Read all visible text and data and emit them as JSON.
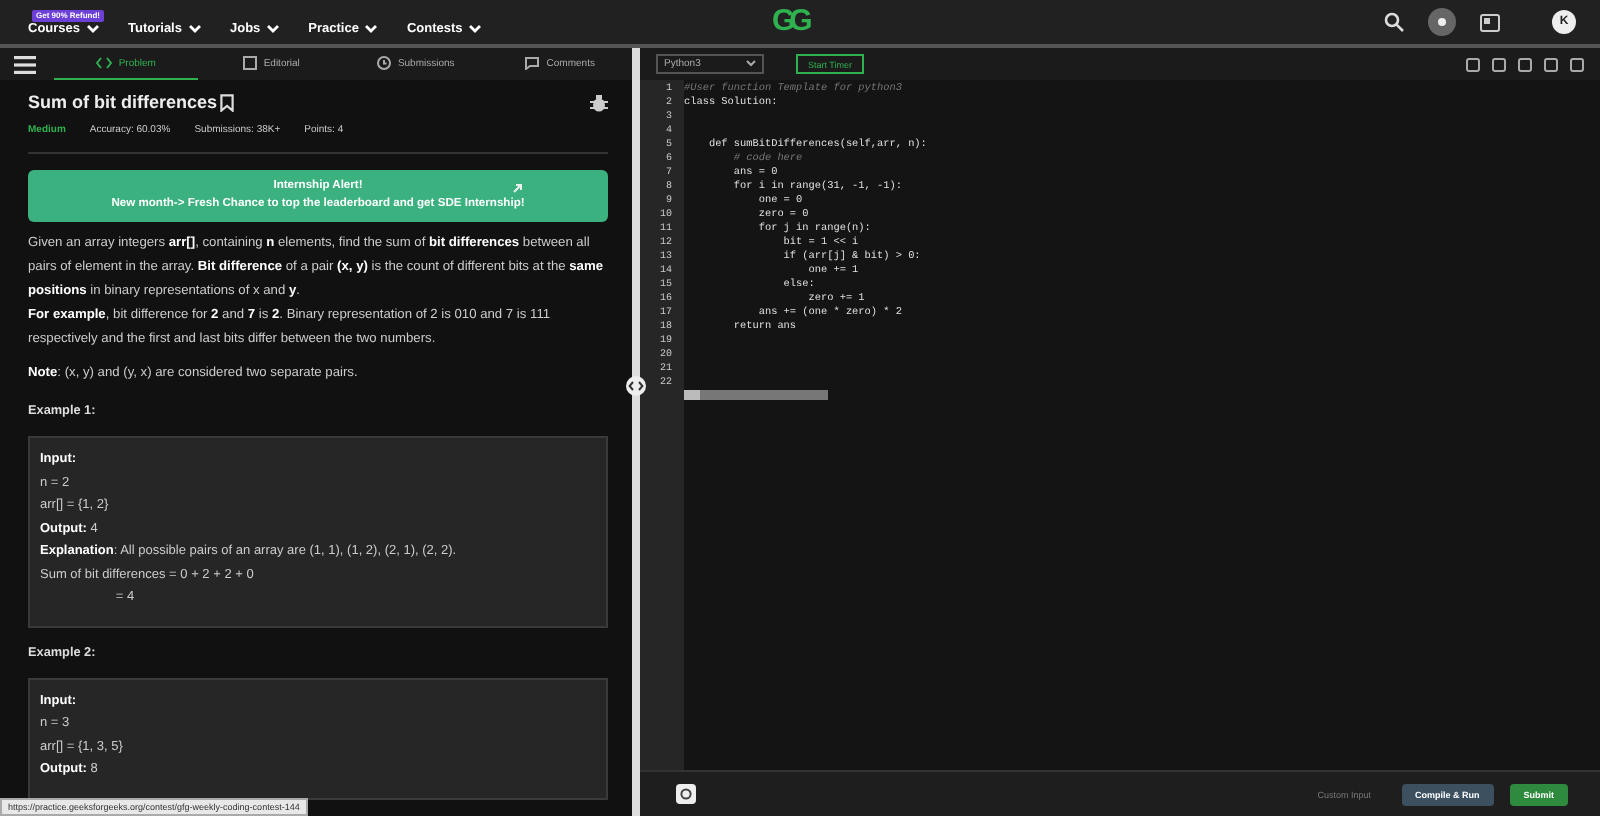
{
  "nav": {
    "badge": "Get 90% Refund!",
    "menus": [
      "Courses",
      "Tutorials",
      "Jobs",
      "Practice",
      "Contests"
    ],
    "logo": "GG",
    "avatar": "K"
  },
  "tabs": [
    {
      "label": "Problem",
      "selected": true
    },
    {
      "label": "Editorial",
      "selected": false
    },
    {
      "label": "Submissions",
      "selected": false
    },
    {
      "label": "Comments",
      "selected": false
    }
  ],
  "problem": {
    "title": "Sum of bit differences",
    "difficulty": "Medium",
    "stats": [
      "Accuracy: 60.03%",
      "Submissions: 38K+",
      "Points: 4"
    ],
    "alert": [
      "Internship Alert!",
      "New month-> Fresh Chance to top the leaderboard and get SDE Internship!"
    ],
    "paragraphs": [
      "Given an array integers **arr[]**, containing **n** elements, find the sum of **bit differences** between all pairs of element in the array. **Bit difference** of a pair **(x, y)** is the count of different bits at the **same positions** in binary representations of x and **y**.\n**For example**, bit difference for **2** and **7** is **2**. Binary representation of 2 is 010 and 7 is 111 respectively and the first and last bits differ between the two numbers.",
      "**Note**: (x, y) and (y, x) are considered two separate pairs."
    ],
    "examples": [
      {
        "heading": "Example 1:",
        "lines": [
          "**Input:**",
          "n = 2",
          "arr[] = {1, 2}",
          "**Output:** 4",
          "**Explanation**: All possible pairs of an array are (1, 1), (1, 2), (2, 1), (2, 2).",
          "Sum of bit differences = 0 + 2 + 2 + 0",
          "                     = 4"
        ]
      },
      {
        "heading": "Example 2:",
        "lines": [
          "**Input:**",
          "n = 3",
          "arr[] = {1, 3, 5}",
          "**Output:** 8"
        ]
      }
    ]
  },
  "editor": {
    "language": "Python3",
    "timer": "Start Timer",
    "code": [
      {
        "number": "1",
        "text": "#User function Template for python3",
        "kind": "comment"
      },
      {
        "number": "2",
        "text": "class Solution:",
        "kind": "code"
      },
      {
        "number": "3",
        "kind": "code"
      },
      {
        "number": "4",
        "kind": "code"
      },
      {
        "number": "5",
        "text": "    def sumBitDifferences(self,arr, n):",
        "kind": "code"
      },
      {
        "number": "6",
        "text": "        # code here",
        "kind": "comment"
      },
      {
        "number": "7",
        "text": "        ans = 0",
        "kind": "code"
      },
      {
        "number": "8",
        "text": "        for i in range(31, -1, -1):",
        "kind": "code"
      },
      {
        "number": "9",
        "text": "            one = 0",
        "kind": "code"
      },
      {
        "number": "10",
        "text": "            zero = 0",
        "kind": "code"
      },
      {
        "number": "11",
        "text": "            for j in range(n):",
        "kind": "code"
      },
      {
        "number": "12",
        "text": "                bit = 1 << i",
        "kind": "code"
      },
      {
        "number": "13",
        "text": "                if (arr[j] & bit) > 0:",
        "kind": "code"
      },
      {
        "number": "14",
        "text": "                    one += 1",
        "kind": "code"
      },
      {
        "number": "15",
        "text": "                else:",
        "kind": "code"
      },
      {
        "number": "16",
        "text": "                    zero += 1",
        "kind": "code"
      },
      {
        "number": "17",
        "text": "            ans += (one * zero) * 2",
        "kind": "code"
      },
      {
        "number": "18",
        "text": "        return ans",
        "kind": "code"
      },
      {
        "number": "19",
        "kind": "code"
      },
      {
        "number": "20",
        "kind": "code"
      },
      {
        "number": "21",
        "kind": "code"
      },
      {
        "number": "22",
        "kind": "code"
      }
    ],
    "buttons": [
      {
        "label": "Custom Input",
        "kind": "link"
      },
      {
        "label": "Compile & Run",
        "kind": "secondary"
      },
      {
        "label": "Submit",
        "kind": "primary"
      }
    ]
  },
  "status_url": "https://practice.geeksforgeeks.org/contest/gfg-weekly-coding-contest-144"
}
